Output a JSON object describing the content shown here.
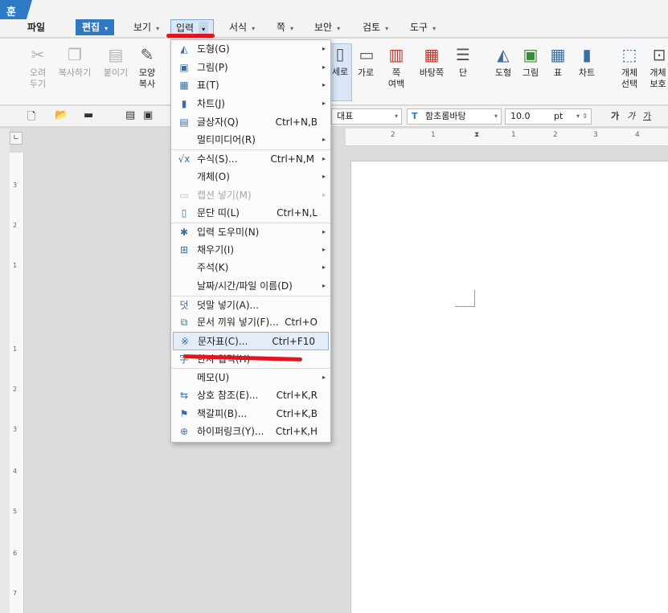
{
  "app": {
    "logo_text": "훈"
  },
  "menubar": {
    "tabs": [
      {
        "label": "파일"
      },
      {
        "label": "편집"
      },
      {
        "label": "보기"
      },
      {
        "label": "입력"
      },
      {
        "label": "서식"
      },
      {
        "label": "쪽"
      },
      {
        "label": "보안"
      },
      {
        "label": "검토"
      },
      {
        "label": "도구"
      }
    ]
  },
  "ribbon": {
    "cut": "오려\n두기",
    "copy": "복사하기",
    "paste": "붙이기",
    "shape_copy": "모양\n복사",
    "vertical": "세로",
    "horizontal": "가로",
    "page_margin": "쪽\n여백",
    "bg_page": "바탕쪽",
    "column": "단",
    "shape": "도형",
    "picture": "그림",
    "table": "표",
    "chart": "차트",
    "obj_select": "개체\n선택",
    "obj_protect": "개체\n보호"
  },
  "toolbar2": {
    "style": "대표",
    "font": "함초롬바탕",
    "size": "10.0",
    "unit": "pt",
    "bold": "가",
    "italic": "가",
    "underline": "가"
  },
  "hruler": {
    "ticks": [
      "2",
      "1",
      "1",
      "2",
      "3",
      "4"
    ]
  },
  "vruler": {
    "ticks": [
      "3",
      "2",
      "1",
      "1",
      "2",
      "3",
      "4",
      "5",
      "6",
      "7"
    ]
  },
  "insert_menu": {
    "items": [
      {
        "icon": "shape-icon",
        "glyph": "◭",
        "label": "도형(G)",
        "shortcut": "",
        "sub": true
      },
      {
        "icon": "picture-icon",
        "glyph": "▣",
        "label": "그림(P)",
        "shortcut": "",
        "sub": true
      },
      {
        "icon": "table-icon",
        "glyph": "▦",
        "label": "표(T)",
        "shortcut": "",
        "sub": true
      },
      {
        "icon": "chart-icon",
        "glyph": "▮",
        "label": "차트(J)",
        "shortcut": "",
        "sub": true
      },
      {
        "icon": "textbox-icon",
        "glyph": "▤",
        "label": "글상자(Q)",
        "shortcut": "Ctrl+N,B",
        "sub": false
      },
      {
        "icon": "",
        "glyph": "",
        "label": "멀티미디어(R)",
        "shortcut": "",
        "sub": true
      },
      {
        "icon": "formula-icon",
        "glyph": "√x",
        "label": "수식(S)...",
        "shortcut": "Ctrl+N,M",
        "sub": true
      },
      {
        "icon": "",
        "glyph": "",
        "label": "개체(O)",
        "shortcut": "",
        "sub": true
      },
      {
        "icon": "caption-icon",
        "glyph": "▭",
        "label": "캡션 넣기(M)",
        "shortcut": "",
        "sub": true,
        "disabled": true
      },
      {
        "icon": "paragraph-band-icon",
        "glyph": "▯",
        "label": "문단 띠(L)",
        "shortcut": "Ctrl+N,L",
        "sub": false
      },
      {
        "icon": "input-helper-icon",
        "glyph": "✱",
        "label": "입력 도우미(N)",
        "shortcut": "",
        "sub": true
      },
      {
        "icon": "fill-icon",
        "glyph": "⊞",
        "label": "채우기(I)",
        "shortcut": "",
        "sub": true
      },
      {
        "icon": "",
        "glyph": "",
        "label": "주석(K)",
        "shortcut": "",
        "sub": true
      },
      {
        "icon": "",
        "glyph": "",
        "label": "날짜/시간/파일 이름(D)",
        "shortcut": "",
        "sub": true
      },
      {
        "icon": "overwrite-icon",
        "glyph": "덧",
        "label": "덧말 넣기(A)...",
        "shortcut": "",
        "sub": false
      },
      {
        "icon": "insert-doc-icon",
        "glyph": "⧉",
        "label": "문서 끼워 넣기(F)...",
        "shortcut": "Ctrl+O",
        "sub": false
      },
      {
        "icon": "charmap-icon",
        "glyph": "※",
        "label": "문자표(C)...",
        "shortcut": "Ctrl+F10",
        "sub": false,
        "highlighted": true
      },
      {
        "icon": "hanja-icon",
        "glyph": "字",
        "label": "한자 입력(H)",
        "shortcut": "",
        "sub": false
      },
      {
        "icon": "",
        "glyph": "",
        "label": "메모(U)",
        "shortcut": "",
        "sub": true
      },
      {
        "icon": "crossref-icon",
        "glyph": "⇆",
        "label": "상호 참조(E)...",
        "shortcut": "Ctrl+K,R",
        "sub": false
      },
      {
        "icon": "bookmark-icon",
        "glyph": "⚑",
        "label": "책갈피(B)...",
        "shortcut": "Ctrl+K,B",
        "sub": false
      },
      {
        "icon": "hyperlink-icon",
        "glyph": "⊕",
        "label": "하이퍼링크(Y)...",
        "shortcut": "Ctrl+K,H",
        "sub": false
      }
    ]
  },
  "colors": {
    "accent": "#2d79c6",
    "annotation_red": "#e0151e"
  }
}
